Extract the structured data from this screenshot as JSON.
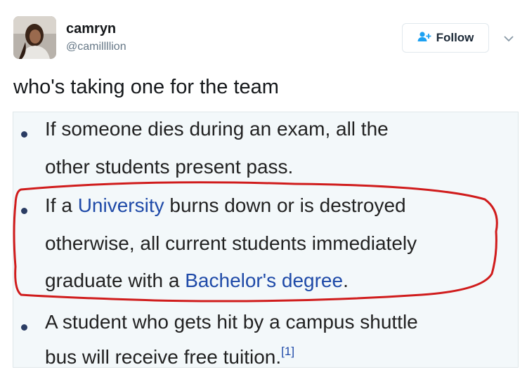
{
  "user": {
    "name": "camryn",
    "handle": "@camillllion"
  },
  "follow_button": {
    "label": "Follow",
    "icon": "add-user-icon"
  },
  "menu_icon": "chevron-down-icon",
  "tweet": {
    "text": "who's taking one for the team"
  },
  "wiki_excerpt": {
    "bullets": [
      {
        "line1": "If someone dies during an exam, all the",
        "line2": "other students present pass."
      },
      {
        "line1_pre": "If a ",
        "line1_link": "University",
        "line1_post": " burns down or is destroyed",
        "line2": "otherwise, all current students immediately",
        "line3_pre": "graduate with a ",
        "line3_link": "Bachelor's degree",
        "line3_post": "."
      },
      {
        "line1": "A student who gets hit by a campus shuttle",
        "line2": "bus will receive free tuition.",
        "citation": "[1]"
      }
    ],
    "highlight_color": "#d01c1c",
    "link_color": "#1f4aa8"
  }
}
